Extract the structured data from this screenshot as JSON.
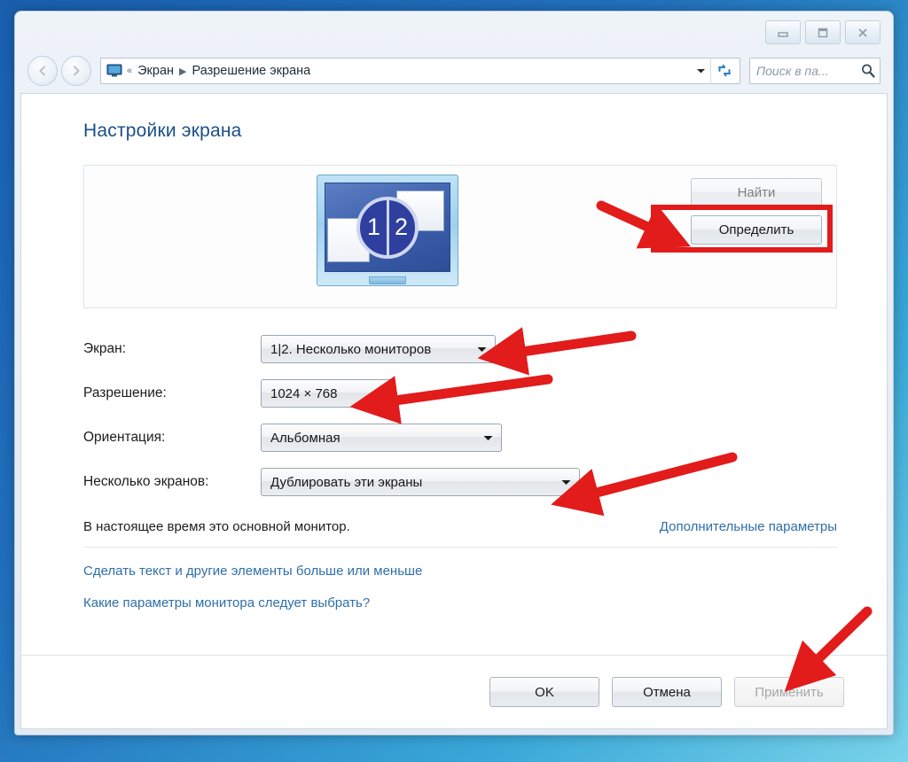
{
  "window": {
    "controls": {
      "minimize": "minimize-button",
      "maximize": "maximize-button",
      "close": "close-button"
    }
  },
  "navbar": {
    "back_label": "Назад",
    "forward_label": "Вперёд",
    "breadcrumb": {
      "overflow": "«",
      "items": [
        "Экран",
        "Разрешение экрана"
      ],
      "separator": "▶"
    },
    "refresh_label": "Обновить",
    "search": {
      "placeholder": "Поиск в па...",
      "value": ""
    }
  },
  "main": {
    "title": "Настройки экрана",
    "preview": {
      "badge_left": "1",
      "badge_right": "2"
    },
    "panel_buttons": {
      "detect": "Найти",
      "identify": "Определить"
    },
    "fields": [
      {
        "label": "Экран:",
        "value": "1|2. Несколько мониторов",
        "name": "display-select",
        "width": "w-screen"
      },
      {
        "label": "Разрешение:",
        "value": "1024 × 768",
        "name": "resolution-select",
        "width": "w-res"
      },
      {
        "label": "Ориентация:",
        "value": "Альбомная",
        "name": "orientation-select",
        "width": "w-orient"
      },
      {
        "label": "Несколько экранов:",
        "value": "Дублировать эти экраны",
        "name": "multiple-displays-select",
        "width": "w-multi"
      }
    ],
    "status_text": "В настоящее время это основной монитор.",
    "advanced_link": "Дополнительные параметры",
    "links": [
      "Сделать текст и другие элементы больше или меньше",
      "Какие параметры монитора следует выбрать?"
    ]
  },
  "footer": {
    "ok": "OK",
    "cancel": "Отмена",
    "apply": "Применить"
  },
  "annotations": {
    "color": "#e21b1b",
    "arrow_count": 5,
    "highlight_target": "Определить"
  },
  "colors": {
    "desktop_blue": "#1a5fae",
    "title_blue": "#1b4f86",
    "link_blue": "#2f6fa8",
    "annotation_red": "#e21b1b",
    "monitor_screen": "#3f62ae"
  }
}
